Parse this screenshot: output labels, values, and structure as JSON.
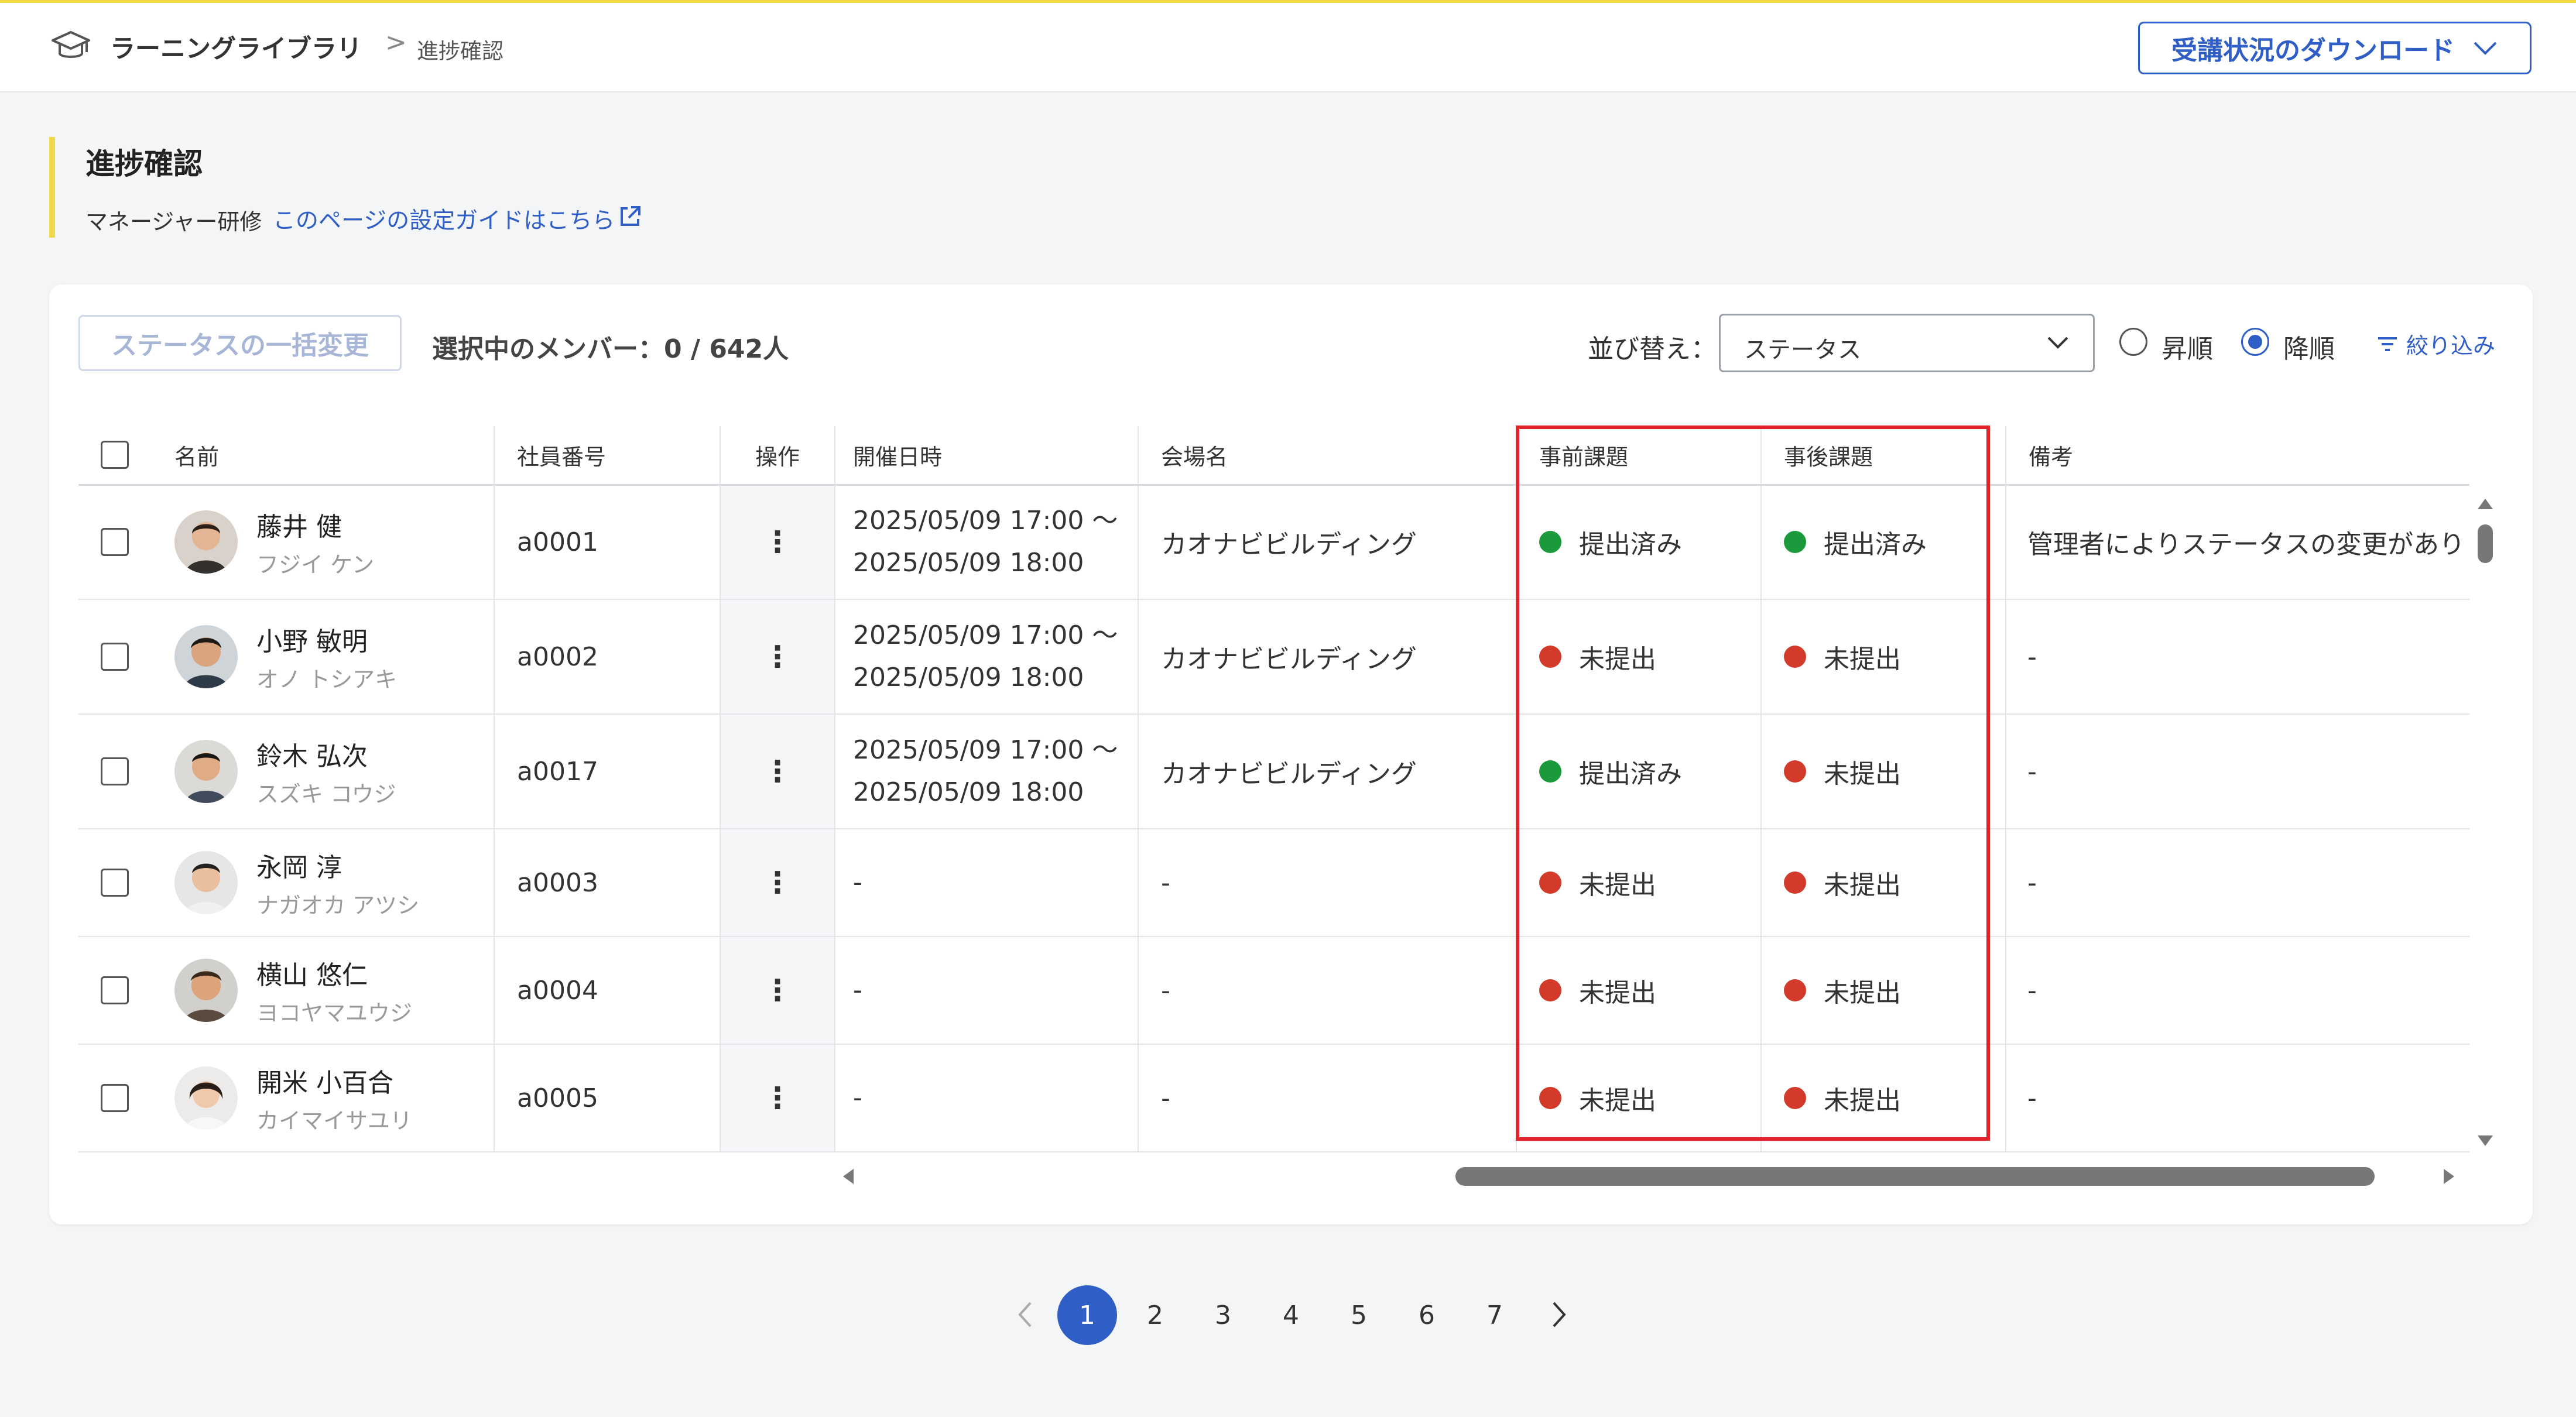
{
  "header": {
    "app_title": "ラーニングライブラリ",
    "breadcrumb_sep": ">",
    "breadcrumb_current": "進捗確認",
    "download_button": "受講状況のダウンロード",
    "icon": "graduation-cap-icon"
  },
  "page": {
    "title": "進捗確認",
    "subtitle": "マネージャー研修",
    "guide_link": "このページの設定ガイドはこちら",
    "accent_color": "#f1d64a"
  },
  "toolbar": {
    "bulk_button": "ステータスの一括変更",
    "selected_count": "選択中のメンバー：0 / 642人",
    "sort_label": "並び替え：",
    "sort_value": "ステータス",
    "asc_label": "昇順",
    "desc_label": "降順",
    "sort_order_selected": "降順",
    "filter_label": "絞り込み"
  },
  "table": {
    "columns": [
      "名前",
      "社員番号",
      "操作",
      "開催日時",
      "会場名",
      "事前課題",
      "事後課題",
      "備考"
    ],
    "rows": [
      {
        "name": "藤井 健",
        "kana": "フジイ ケン",
        "id": "a0001",
        "date1": "2025/05/09 17:00 〜",
        "date2": "2025/05/09 18:00",
        "venue": "カオナビビルディング",
        "pre": "提出済み",
        "pre_status": "done",
        "post": "提出済み",
        "post_status": "done",
        "note": "管理者によりステータスの変更があり"
      },
      {
        "name": "小野 敏明",
        "kana": "オノ トシアキ",
        "id": "a0002",
        "date1": "2025/05/09 17:00 〜",
        "date2": "2025/05/09 18:00",
        "venue": "カオナビビルディング",
        "pre": "未提出",
        "pre_status": "todo",
        "post": "未提出",
        "post_status": "todo",
        "note": "-"
      },
      {
        "name": "鈴木 弘次",
        "kana": "スズキ コウジ",
        "id": "a0017",
        "date1": "2025/05/09 17:00 〜",
        "date2": "2025/05/09 18:00",
        "venue": "カオナビビルディング",
        "pre": "提出済み",
        "pre_status": "done",
        "post": "未提出",
        "post_status": "todo",
        "note": "-"
      },
      {
        "name": "永岡 淳",
        "kana": "ナガオカ アツシ",
        "id": "a0003",
        "date1": "-",
        "date2": "",
        "venue": "-",
        "pre": "未提出",
        "pre_status": "todo",
        "post": "未提出",
        "post_status": "todo",
        "note": "-"
      },
      {
        "name": "横山 悠仁",
        "kana": "ヨコヤマユウジ",
        "id": "a0004",
        "date1": "-",
        "date2": "",
        "venue": "-",
        "pre": "未提出",
        "pre_status": "todo",
        "post": "未提出",
        "post_status": "todo",
        "note": "-"
      },
      {
        "name": "開米 小百合",
        "kana": "カイマイサユリ",
        "id": "a0005",
        "date1": "-",
        "date2": "",
        "venue": "-",
        "pre": "未提出",
        "pre_status": "todo",
        "post": "未提出",
        "post_status": "todo",
        "note": "-"
      }
    ],
    "status_colors": {
      "done": "#1a9a3a",
      "todo": "#d23a2a"
    },
    "highlight_color": "#e1232a"
  },
  "pagination": {
    "pages": [
      "1",
      "2",
      "3",
      "4",
      "5",
      "6",
      "7"
    ],
    "current": "1"
  }
}
